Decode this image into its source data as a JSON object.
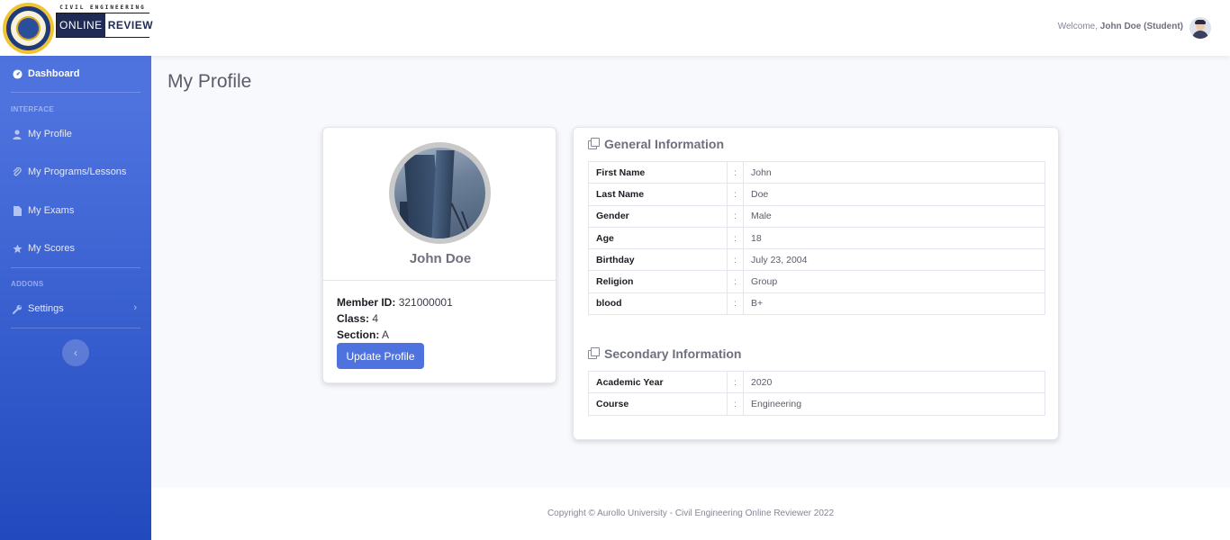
{
  "brand": {
    "top_text": "CIVIL ENGINEERING",
    "online": "ONLINE",
    "review": "REVIEW"
  },
  "topbar": {
    "welcome_prefix": "Welcome,",
    "user": "John Doe (Student)"
  },
  "sidebar": {
    "dashboard": "Dashboard",
    "heading_interface": "INTERFACE",
    "items": [
      {
        "label": "My Profile",
        "icon": "user-icon"
      },
      {
        "label": "My Programs/Lessons",
        "icon": "paperclip-icon"
      },
      {
        "label": "My Exams",
        "icon": "file-icon"
      },
      {
        "label": "My Scores",
        "icon": "star-icon"
      }
    ],
    "heading_addons": "ADDONS",
    "settings": "Settings",
    "toggle_symbol": "‹"
  },
  "main": {
    "title": "My Profile",
    "profile": {
      "name": "John Doe",
      "member_id_label": "Member ID:",
      "member_id": "321000001",
      "class_label": "Class:",
      "class": "4",
      "section_label": "Section:",
      "section": "A",
      "button": "Update Profile"
    },
    "general": {
      "title": "General Information",
      "rows": [
        {
          "k": "First Name",
          "sep": ":",
          "v": "John"
        },
        {
          "k": "Last Name",
          "sep": ":",
          "v": "Doe"
        },
        {
          "k": "Gender",
          "sep": ":",
          "v": "Male"
        },
        {
          "k": "Age",
          "sep": ":",
          "v": "18"
        },
        {
          "k": "Birthday",
          "sep": ":",
          "v": "July 23, 2004"
        },
        {
          "k": "Religion",
          "sep": ":",
          "v": "Group"
        },
        {
          "k": "blood",
          "sep": ":",
          "v": "B+"
        }
      ]
    },
    "secondary": {
      "title": "Secondary Information",
      "rows": [
        {
          "k": "Academic Year",
          "sep": ":",
          "v": "2020"
        },
        {
          "k": "Course",
          "sep": ":",
          "v": "Engineering"
        }
      ]
    }
  },
  "footer": {
    "text": "Copyright © Aurollo University - Civil Engineering Online Reviewer 2022"
  },
  "colors": {
    "primary": "#4e73df",
    "sidebar_bottom": "#224abe",
    "background": "#f8f9fc"
  }
}
